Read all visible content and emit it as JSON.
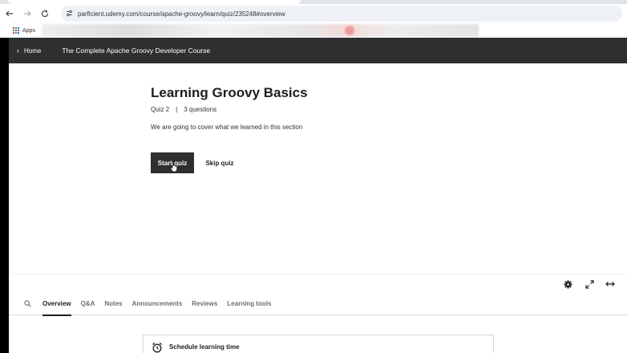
{
  "browser": {
    "url": "parficient.udemy.com/course/apache-groovy/learn/quiz/235248#overview",
    "bookmarks_label": "Apps"
  },
  "course_bar": {
    "home_label": "Home",
    "course_title": "The Complete Apache Groovy Developer Course"
  },
  "quiz": {
    "title": "Learning Groovy Basics",
    "number": "Quiz 2",
    "separator": "|",
    "questions": "3 questions",
    "description": "We are going to cover what we learned in this section",
    "start_label": "Start quiz",
    "skip_label": "Skip quiz"
  },
  "tabs": [
    {
      "label": "Overview",
      "active": true
    },
    {
      "label": "Q&A"
    },
    {
      "label": "Notes"
    },
    {
      "label": "Announcements"
    },
    {
      "label": "Reviews"
    },
    {
      "label": "Learning tools"
    }
  ],
  "schedule": {
    "title": "Schedule learning time"
  },
  "icons": {
    "search": "search-icon",
    "settings": "gear-icon",
    "fullscreen": "expand-icon",
    "wide": "expand-width-icon",
    "alarm": "alarm-clock-icon"
  },
  "colors": {
    "dark": "#2d2f31",
    "text": "#1c1d1f",
    "muted": "#6a6f73"
  }
}
